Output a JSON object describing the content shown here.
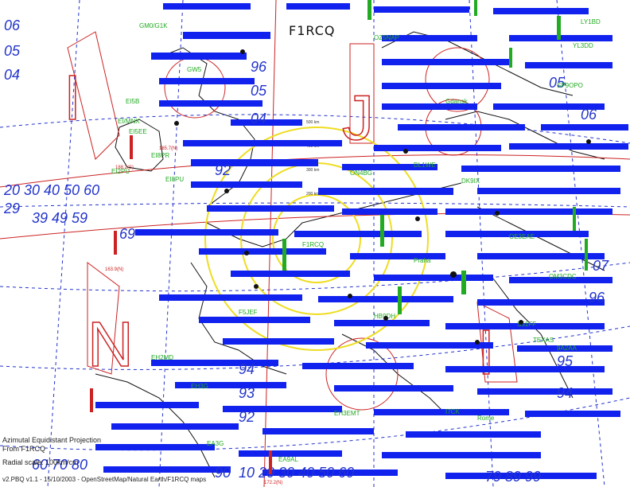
{
  "map": {
    "title": "F1RCQ",
    "projection": "Azimutal Equidistant Projection",
    "center_label": "From F1RCQ",
    "scale": "Radial scale: 100km/cm",
    "footer": "v2.PBQ v1.1 - 15/10/2003 - OpenStreetMap/Natural Earth/F1RCQ maps",
    "grid_letters": [
      "I",
      "N",
      "J",
      "I",
      "N",
      "J",
      "J",
      "I"
    ],
    "ring_labels": [
      "500 km",
      "400 km",
      "300 km",
      "200 km"
    ],
    "station_labels": [
      "GM0/G1K",
      "EI5B",
      "EI/MNX",
      "EI5EE",
      "EI2PU",
      "EI8PR",
      "GW5",
      "EI8PU",
      "F1RCQ",
      "DL1WE",
      "DK9IX",
      "ON4BG",
      "OZ5NAP",
      "SP9OPO",
      "YL3DD",
      "LY1BD",
      "OE3EAE",
      "OM3CDC",
      "S51FF",
      "9A2AA",
      "HB9DH",
      "F5JEF",
      "EA3G",
      "EH2MD",
      "EH3G",
      "EH3EMT",
      "EA9AL",
      "I7CK",
      "TEXAS",
      "Rome",
      "Gdansk",
      "Praha"
    ],
    "path_labels": [
      "185.7(N)",
      "188.2(S)",
      "163.9(N)",
      "172.2(N)"
    ],
    "colors": {
      "grid": "#2233cc",
      "rings": "#cc2222",
      "range_circles": "#eedd22",
      "border": "#111111",
      "stations": "#22aa22",
      "spots": "#1122ee"
    }
  }
}
